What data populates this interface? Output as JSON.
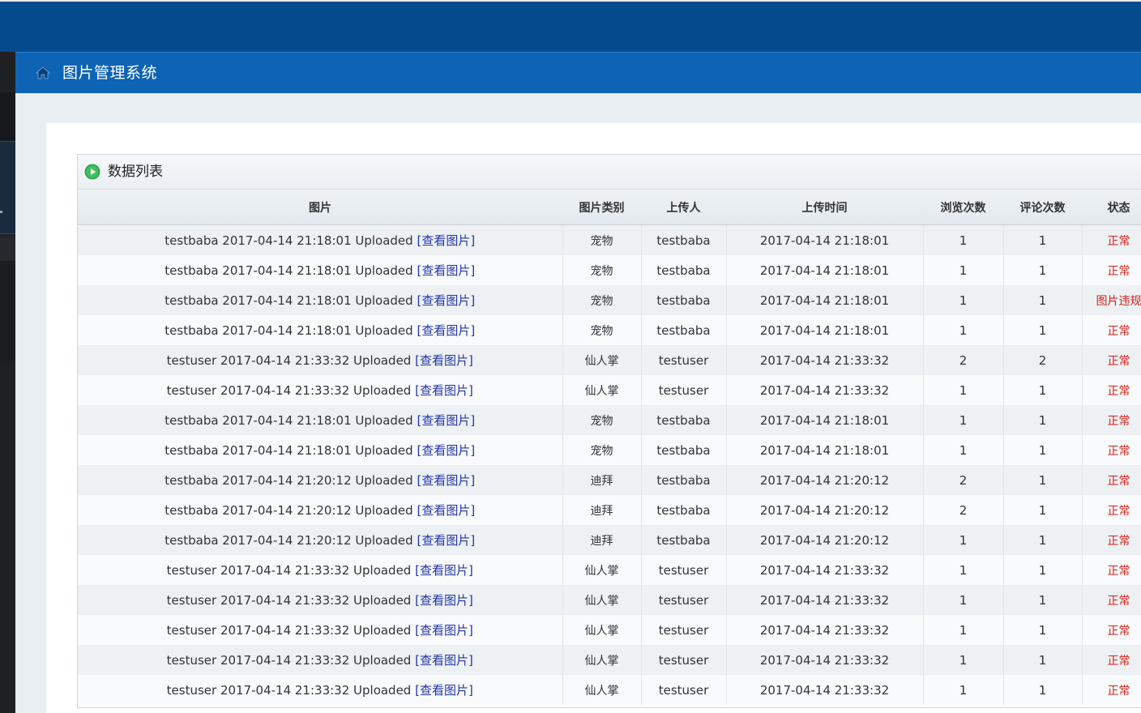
{
  "header": {
    "title": "图片管理系统"
  },
  "panel": {
    "title": "数据列表"
  },
  "table": {
    "columns": [
      "图片",
      "图片类别",
      "上传人",
      "上传时间",
      "浏览次数",
      "评论次数",
      "状态"
    ],
    "link_label": "[查看图片]",
    "rows": [
      {
        "image": "testbaba 2017-04-14 21:18:01 Uploaded",
        "category": "宠物",
        "uploader": "testbaba",
        "time": "2017-04-14 21:18:01",
        "views": "1",
        "comments": "1",
        "status": "正常"
      },
      {
        "image": "testbaba 2017-04-14 21:18:01 Uploaded",
        "category": "宠物",
        "uploader": "testbaba",
        "time": "2017-04-14 21:18:01",
        "views": "1",
        "comments": "1",
        "status": "正常"
      },
      {
        "image": "testbaba 2017-04-14 21:18:01 Uploaded",
        "category": "宠物",
        "uploader": "testbaba",
        "time": "2017-04-14 21:18:01",
        "views": "1",
        "comments": "1",
        "status": "图片违规"
      },
      {
        "image": "testbaba 2017-04-14 21:18:01 Uploaded",
        "category": "宠物",
        "uploader": "testbaba",
        "time": "2017-04-14 21:18:01",
        "views": "1",
        "comments": "1",
        "status": "正常"
      },
      {
        "image": "testuser 2017-04-14 21:33:32 Uploaded",
        "category": "仙人掌",
        "uploader": "testuser",
        "time": "2017-04-14 21:33:32",
        "views": "2",
        "comments": "2",
        "status": "正常"
      },
      {
        "image": "testuser 2017-04-14 21:33:32 Uploaded",
        "category": "仙人掌",
        "uploader": "testuser",
        "time": "2017-04-14 21:33:32",
        "views": "1",
        "comments": "1",
        "status": "正常"
      },
      {
        "image": "testbaba 2017-04-14 21:18:01 Uploaded",
        "category": "宠物",
        "uploader": "testbaba",
        "time": "2017-04-14 21:18:01",
        "views": "1",
        "comments": "1",
        "status": "正常"
      },
      {
        "image": "testbaba 2017-04-14 21:18:01 Uploaded",
        "category": "宠物",
        "uploader": "testbaba",
        "time": "2017-04-14 21:18:01",
        "views": "1",
        "comments": "1",
        "status": "正常"
      },
      {
        "image": "testbaba 2017-04-14 21:20:12 Uploaded",
        "category": "迪拜",
        "uploader": "testbaba",
        "time": "2017-04-14 21:20:12",
        "views": "2",
        "comments": "1",
        "status": "正常"
      },
      {
        "image": "testbaba 2017-04-14 21:20:12 Uploaded",
        "category": "迪拜",
        "uploader": "testbaba",
        "time": "2017-04-14 21:20:12",
        "views": "2",
        "comments": "1",
        "status": "正常"
      },
      {
        "image": "testbaba 2017-04-14 21:20:12 Uploaded",
        "category": "迪拜",
        "uploader": "testbaba",
        "time": "2017-04-14 21:20:12",
        "views": "1",
        "comments": "1",
        "status": "正常"
      },
      {
        "image": "testuser 2017-04-14 21:33:32 Uploaded",
        "category": "仙人掌",
        "uploader": "testuser",
        "time": "2017-04-14 21:33:32",
        "views": "1",
        "comments": "1",
        "status": "正常"
      },
      {
        "image": "testuser 2017-04-14 21:33:32 Uploaded",
        "category": "仙人掌",
        "uploader": "testuser",
        "time": "2017-04-14 21:33:32",
        "views": "1",
        "comments": "1",
        "status": "正常"
      },
      {
        "image": "testuser 2017-04-14 21:33:32 Uploaded",
        "category": "仙人掌",
        "uploader": "testuser",
        "time": "2017-04-14 21:33:32",
        "views": "1",
        "comments": "1",
        "status": "正常"
      },
      {
        "image": "testuser 2017-04-14 21:33:32 Uploaded",
        "category": "仙人掌",
        "uploader": "testuser",
        "time": "2017-04-14 21:33:32",
        "views": "1",
        "comments": "1",
        "status": "正常"
      },
      {
        "image": "testuser 2017-04-14 21:33:32 Uploaded",
        "category": "仙人掌",
        "uploader": "testuser",
        "time": "2017-04-14 21:33:32",
        "views": "1",
        "comments": "1",
        "status": "正常"
      }
    ]
  },
  "colors": {
    "topbar": "#044a8c",
    "header": "#0d63b4",
    "link": "#2235a8",
    "status": "#d4201a"
  },
  "icons": {
    "header": "home-icon",
    "panel": "play-circle-icon"
  }
}
